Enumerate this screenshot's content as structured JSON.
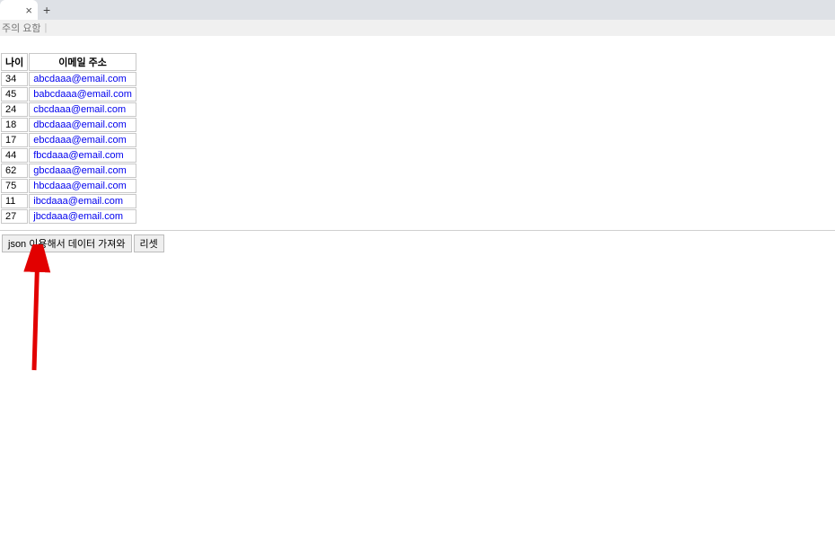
{
  "addressbar": {
    "warning": "주의 요함"
  },
  "table": {
    "headers": {
      "age": "나이",
      "email": "이메일 주소"
    },
    "rows": [
      {
        "age": "34",
        "email": "abcdaaa@email.com"
      },
      {
        "age": "45",
        "email": "babcdaaa@email.com"
      },
      {
        "age": "24",
        "email": "cbcdaaa@email.com"
      },
      {
        "age": "18",
        "email": "dbcdaaa@email.com"
      },
      {
        "age": "17",
        "email": "ebcdaaa@email.com"
      },
      {
        "age": "44",
        "email": "fbcdaaa@email.com"
      },
      {
        "age": "62",
        "email": "gbcdaaa@email.com"
      },
      {
        "age": "75",
        "email": "hbcdaaa@email.com"
      },
      {
        "age": "11",
        "email": "ibcdaaa@email.com"
      },
      {
        "age": "27",
        "email": "jbcdaaa@email.com"
      }
    ]
  },
  "buttons": {
    "fetch": "json 이용해서 데이터 가져와",
    "reset": "리셋"
  }
}
